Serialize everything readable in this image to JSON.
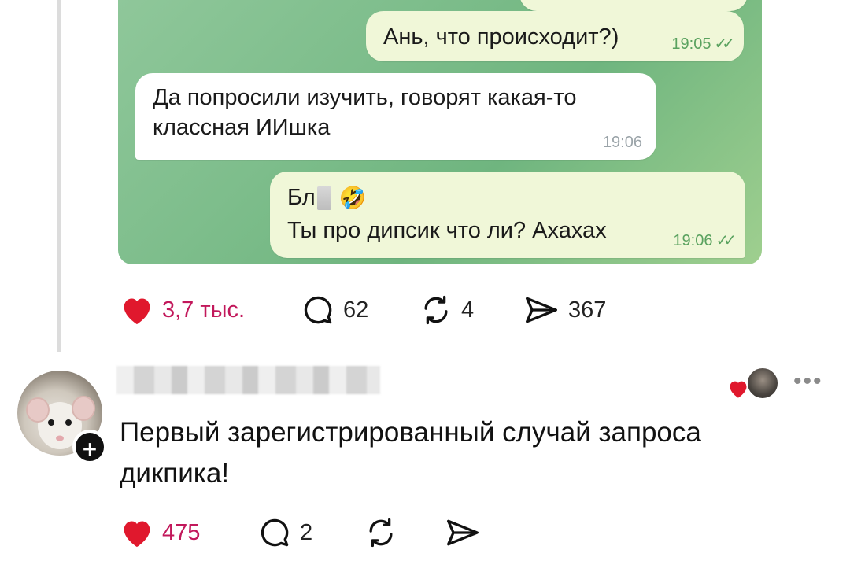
{
  "chat": {
    "msg1": {
      "text": "Ань, что происходит?)",
      "time": "19:05",
      "ticks": "✓✓"
    },
    "msg2": {
      "text": "Да попросили изучить, говорят какая-то классная ИИшка",
      "time": "19:06"
    },
    "msg3": {
      "line1": "Бл",
      "emoji": "🤣",
      "line2": "Ты про дипсик что ли? Ахахах",
      "time": "19:06",
      "ticks": "✓✓"
    }
  },
  "post_actions": {
    "likes": "3,7 тыс.",
    "comments": "62",
    "reposts": "4",
    "shares": "367",
    "liked": true
  },
  "reply": {
    "follow_symbol": "+",
    "text": "Первый зарегистрированный случай запроса дикпика!",
    "more_symbol": "•••",
    "actions": {
      "likes": "475",
      "comments": "2",
      "liked": true
    }
  },
  "colors": {
    "heart": "#e0182d",
    "liked_count": "#c2185b",
    "chat_green": "#7dbd8b",
    "outgoing_bubble": "#f0f7d8"
  },
  "icons": [
    "heart-icon",
    "comment-icon",
    "repost-icon",
    "share-icon",
    "plus-icon",
    "more-icon"
  ]
}
